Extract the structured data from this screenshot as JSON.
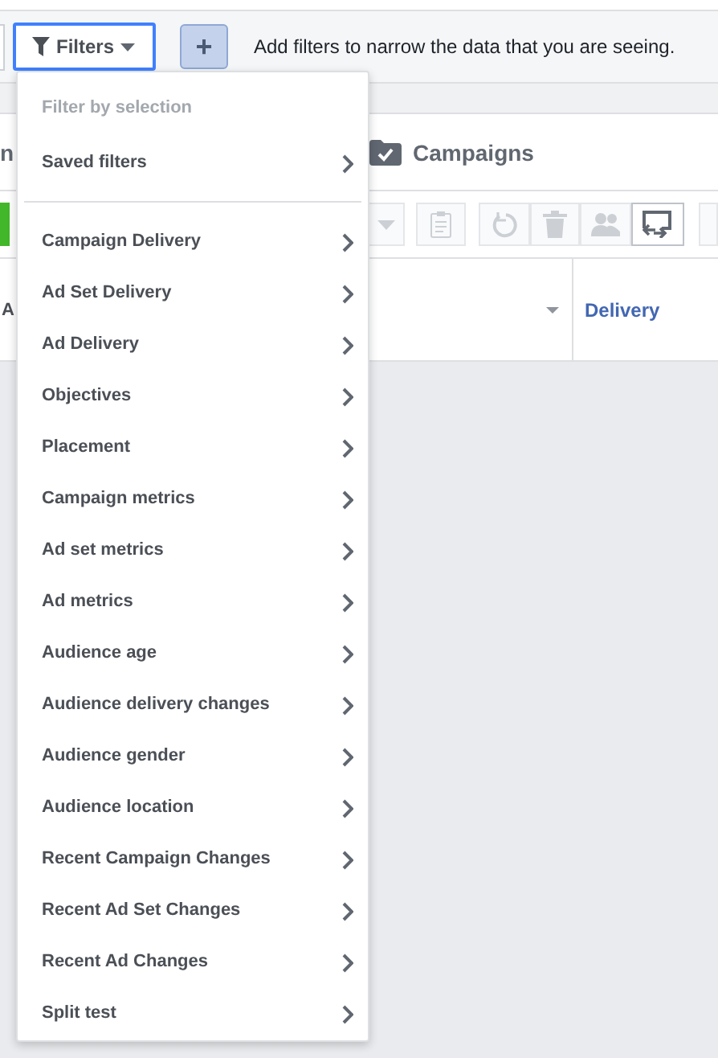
{
  "filter_bar": {
    "filters_button": {
      "label": "Filters",
      "selected": true
    },
    "add_button": {
      "label": "+"
    },
    "hint": "Add filters to narrow the data that you are seeing."
  },
  "tabs": [
    {
      "label": "n",
      "selected": false
    },
    {
      "label": "Campaigns",
      "selected": false
    }
  ],
  "toolbar": [
    {
      "kind": "create",
      "disabled": false
    },
    {
      "kind": "dropdown",
      "disabled": true
    },
    {
      "kind": "clipboard",
      "disabled": true
    },
    {
      "kind": "refresh",
      "disabled": true
    },
    {
      "kind": "trash",
      "disabled": true
    },
    {
      "kind": "people",
      "disabled": true
    },
    {
      "kind": "swap",
      "disabled": false
    },
    {
      "kind": "blank",
      "disabled": true
    }
  ],
  "table": {
    "columns": [
      {
        "label": "A"
      },
      {
        "label": "Delivery"
      }
    ]
  },
  "filter_menu": {
    "header": "Filter by selection",
    "sections": [
      [
        {
          "label": "Saved filters"
        }
      ],
      [
        {
          "label": "Campaign Delivery"
        },
        {
          "label": "Ad Set Delivery"
        },
        {
          "label": "Ad Delivery"
        },
        {
          "label": "Objectives"
        },
        {
          "label": "Placement"
        },
        {
          "label": "Campaign metrics"
        },
        {
          "label": "Ad set metrics"
        },
        {
          "label": "Ad metrics"
        },
        {
          "label": "Audience age"
        },
        {
          "label": "Audience delivery changes"
        },
        {
          "label": "Audience gender"
        },
        {
          "label": "Audience location"
        },
        {
          "label": "Recent Campaign Changes"
        },
        {
          "label": "Recent Ad Set Changes"
        },
        {
          "label": "Recent Ad Changes"
        },
        {
          "label": "Split test"
        }
      ]
    ]
  }
}
